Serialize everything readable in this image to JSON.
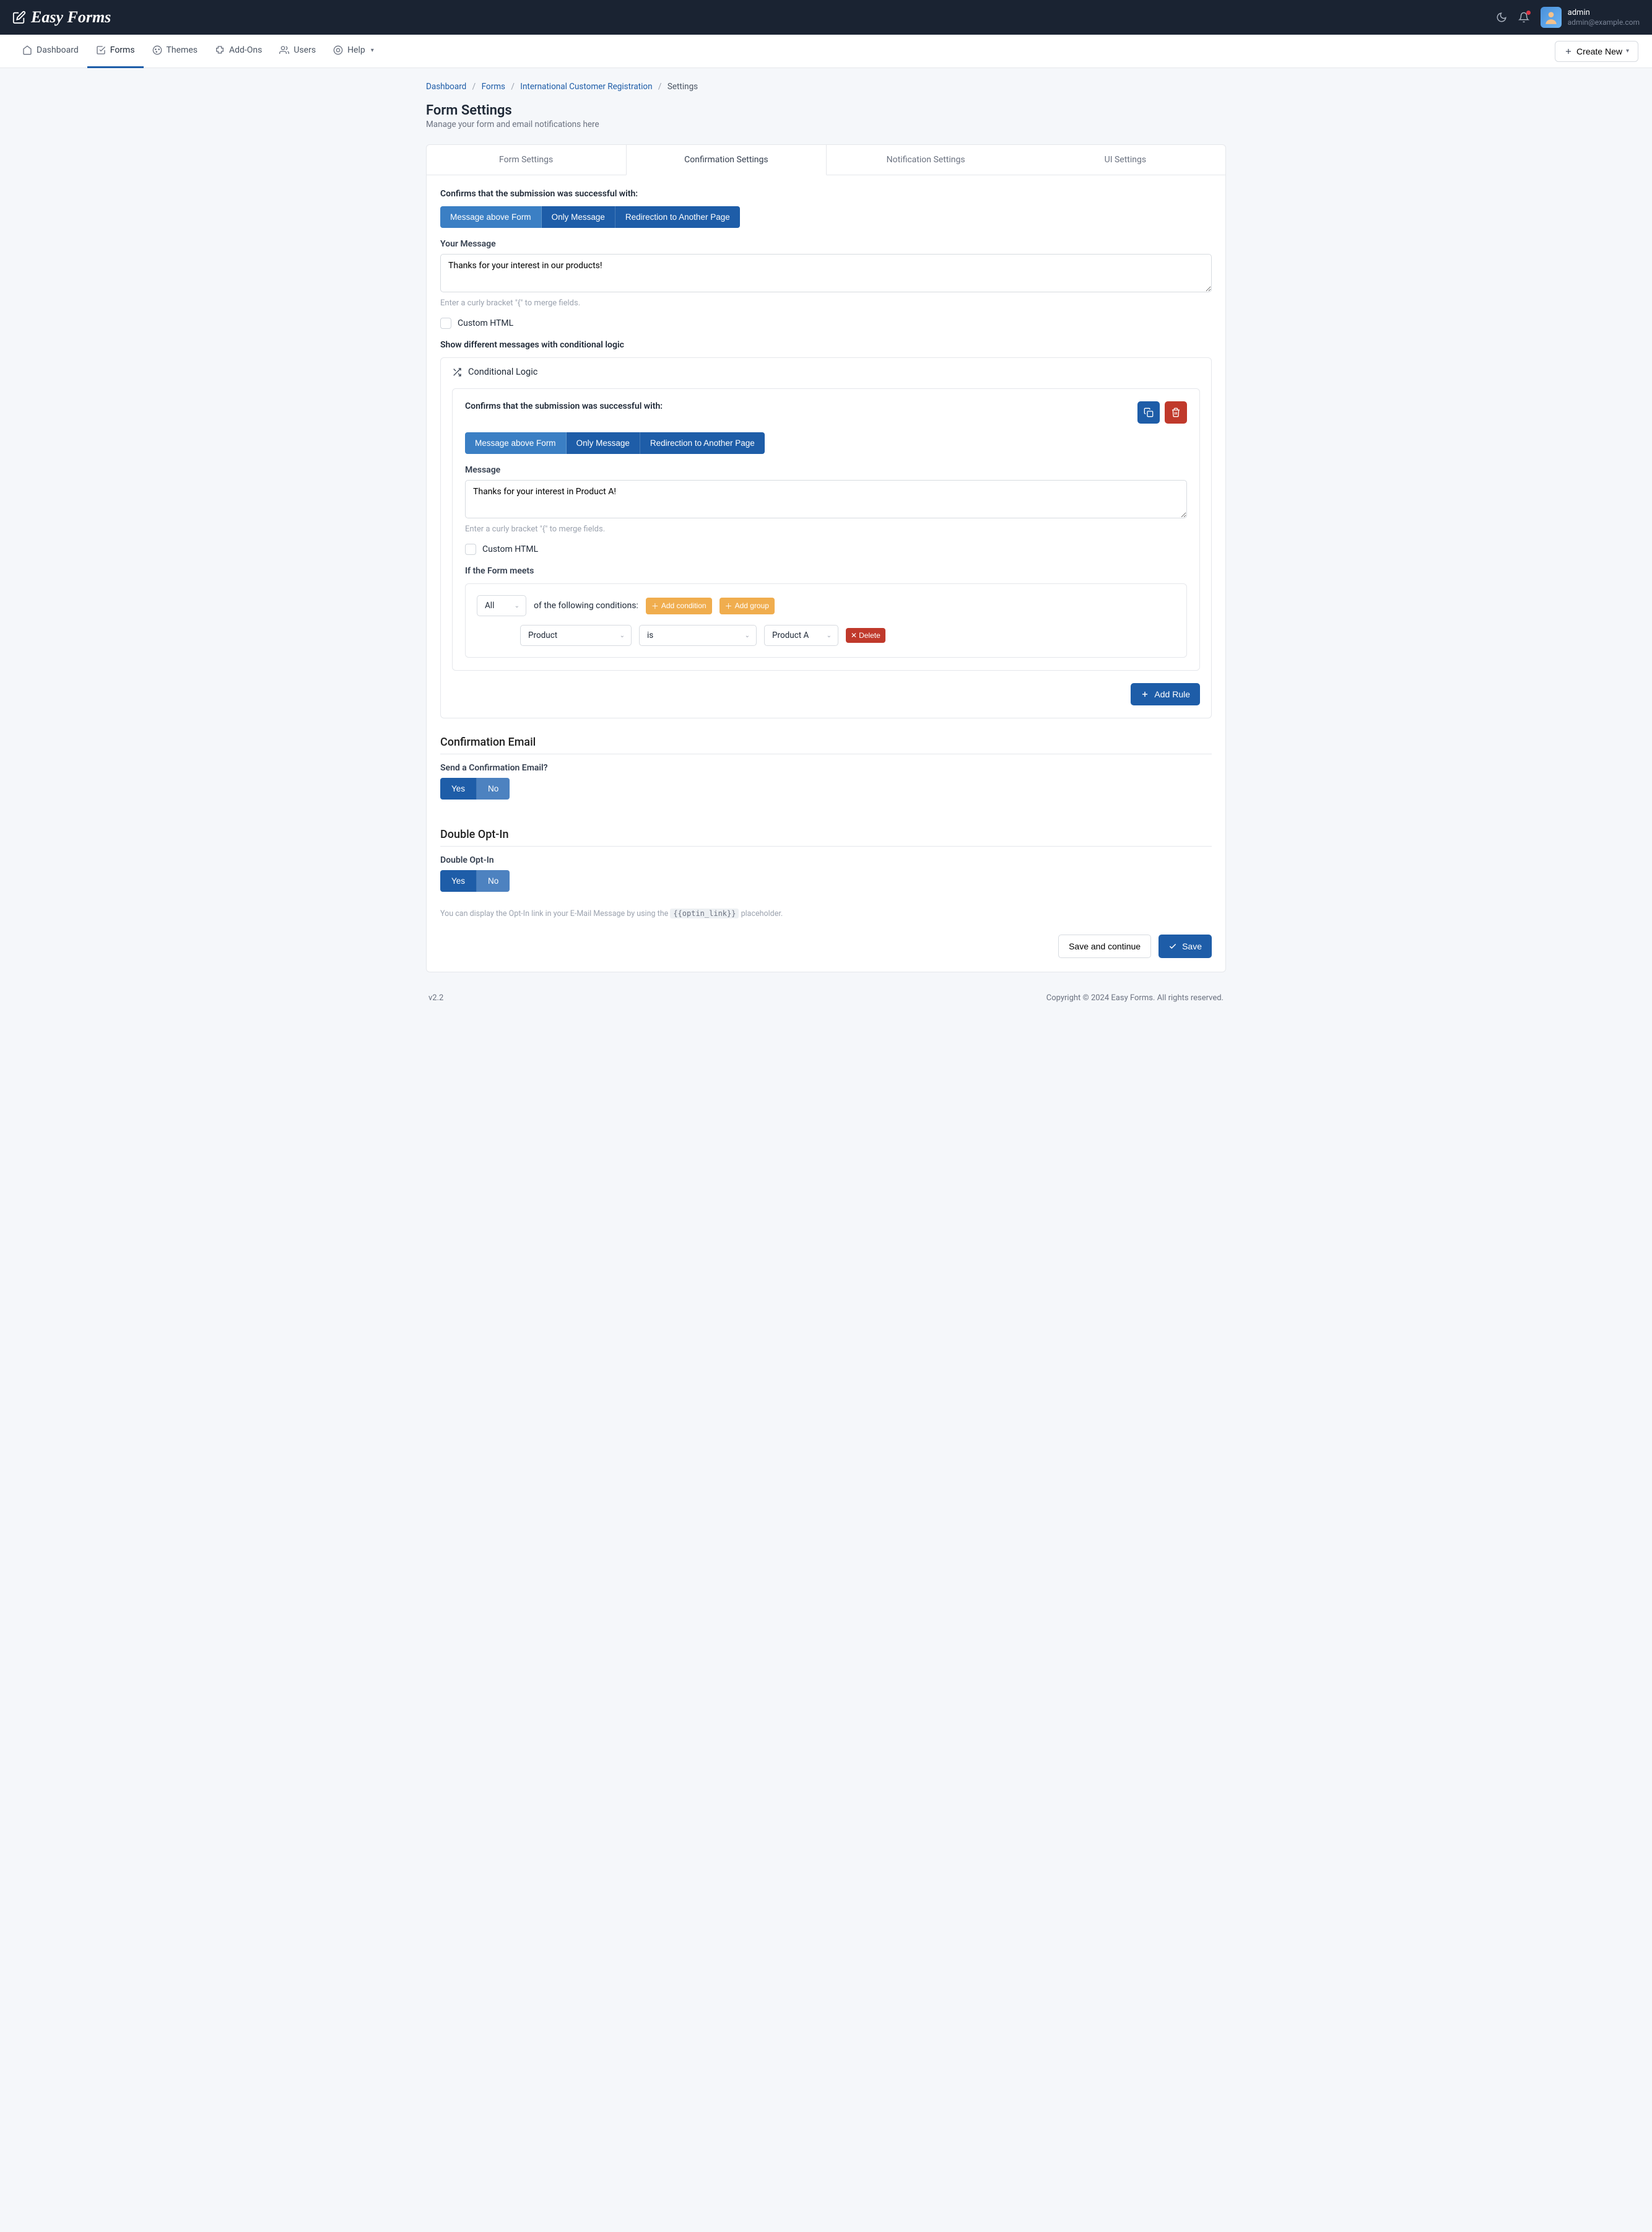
{
  "brand": "Easy Forms",
  "user": {
    "name": "admin",
    "email": "admin@example.com"
  },
  "nav": {
    "dashboard": "Dashboard",
    "forms": "Forms",
    "themes": "Themes",
    "addons": "Add-Ons",
    "users": "Users",
    "help": "Help",
    "create": "Create New"
  },
  "breadcrumb": {
    "dashboard": "Dashboard",
    "forms": "Forms",
    "form_name": "International Customer Registration",
    "current": "Settings"
  },
  "page": {
    "title": "Form Settings",
    "sub": "Manage your form and email notifications here"
  },
  "tabs": {
    "form": "Form Settings",
    "confirmation": "Confirmation Settings",
    "notification": "Notification Settings",
    "ui": "UI Settings"
  },
  "confirm": {
    "heading": "Confirms that the submission was successful with:",
    "opt_above": "Message above Form",
    "opt_only": "Only Message",
    "opt_redirect": "Redirection to Another Page",
    "your_message_label": "Your Message",
    "your_message": "Thanks for your interest in our products!",
    "merge_help": "Enter a curly bracket \"{\" to merge fields.",
    "custom_html": "Custom HTML",
    "cond_heading": "Show different messages with conditional logic",
    "cond_title": "Conditional Logic"
  },
  "rule": {
    "heading": "Confirms that the submission was successful with:",
    "opt_above": "Message above Form",
    "opt_only": "Only Message",
    "opt_redirect": "Redirection to Another Page",
    "message_label": "Message",
    "message": "Thanks for your interest in Product A!",
    "merge_help": "Enter a curly bracket \"{\" to merge fields.",
    "custom_html": "Custom HTML",
    "meets_label": "If the Form meets",
    "scope": "All",
    "scope_after": "of the following conditions:",
    "add_condition": "Add condition",
    "add_group": "Add group",
    "field": "Product",
    "op": "is",
    "value": "Product A",
    "delete": "Delete",
    "add_rule": "Add Rule"
  },
  "email": {
    "section": "Confirmation Email",
    "label": "Send a Confirmation Email?",
    "yes": "Yes",
    "no": "No"
  },
  "optin": {
    "section": "Double Opt-In",
    "label": "Double Opt-In",
    "yes": "Yes",
    "no": "No",
    "help_pre": "You can display the Opt-In link in your E-Mail Message by using the ",
    "placeholder": "{{optin_link}}",
    "help_post": " placeholder."
  },
  "actions": {
    "save_continue": "Save and continue",
    "save": "Save"
  },
  "footer": {
    "version": "v2.2",
    "copyright": "Copyright © 2024 Easy Forms. All rights reserved."
  }
}
